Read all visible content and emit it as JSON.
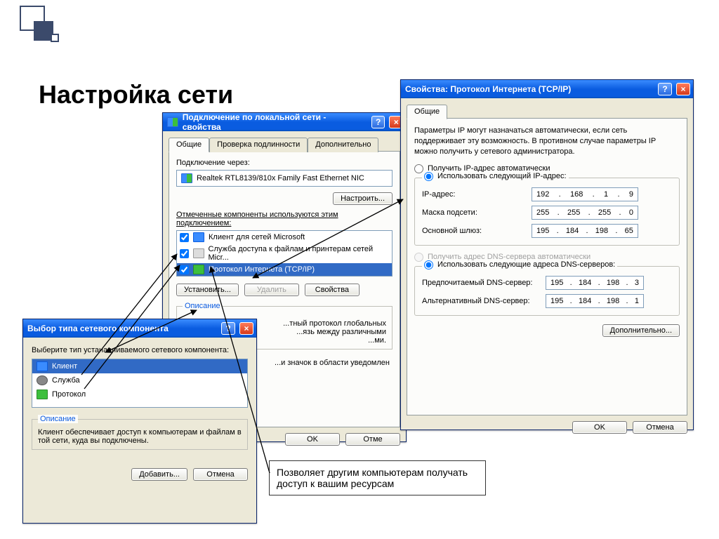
{
  "page_title": "Настройка сети",
  "win_props": {
    "title": "Подключение по локальной сети - свойства",
    "tabs": [
      "Общие",
      "Проверка подлинности",
      "Дополнительно"
    ],
    "connect_label": "Подключение через:",
    "adapter": "Realtek RTL8139/810x Family Fast Ethernet NIC",
    "configure_btn": "Настроить...",
    "components_label": "Отмеченные компоненты используются этим подключением:",
    "items": [
      "Клиент для сетей Microsoft",
      "Служба доступа к файлам и принтерам сетей Micr...",
      "Протокол Интернета (TCP/IP)"
    ],
    "install_btn": "Установить...",
    "remove_btn": "Удалить",
    "props_btn": "Свойства",
    "desc_title": "Описание",
    "desc_body1": "...тный протокол глобальных",
    "desc_body2": "...язь между различными",
    "desc_body3": "...ми.",
    "tray_label": "...и значок в области уведомлен",
    "ok": "OK",
    "cancel": "Отме"
  },
  "win_tcpip": {
    "title": "Свойства: Протокол Интернета (TCP/IP)",
    "tab": "Общие",
    "intro": "Параметры IP могут назначаться автоматически, если сеть поддерживает эту возможность. В противном случае параметры IP можно получить у сетевого администратора.",
    "radio_auto_ip": "Получить IP-адрес автоматически",
    "radio_manual_ip": "Использовать следующий IP-адрес:",
    "ip_label": "IP-адрес:",
    "ip": [
      "192",
      "168",
      "1",
      "9"
    ],
    "mask_label": "Маска подсети:",
    "mask": [
      "255",
      "255",
      "255",
      "0"
    ],
    "gw_label": "Основной шлюз:",
    "gw": [
      "195",
      "184",
      "198",
      "65"
    ],
    "radio_auto_dns": "Получить адрес DNS-сервера автоматически",
    "radio_manual_dns": "Использовать следующие адреса DNS-серверов:",
    "dns1_label": "Предпочитаемый DNS-сервер:",
    "dns1": [
      "195",
      "184",
      "198",
      "3"
    ],
    "dns2_label": "Альтернативный DNS-сервер:",
    "dns2": [
      "195",
      "184",
      "198",
      "1"
    ],
    "adv_btn": "Дополнительно...",
    "ok": "OK",
    "cancel": "Отмена"
  },
  "win_comp": {
    "title": "Выбор типа сетевого компонента",
    "prompt": "Выберите тип устанавливаемого сетевого компонента:",
    "items": [
      "Клиент",
      "Служба",
      "Протокол"
    ],
    "desc_title": "Описание",
    "desc_body": "Клиент обеспечивает доступ к компьютерам и файлам в той сети, куда вы подключены.",
    "add_btn": "Добавить...",
    "cancel_btn": "Отмена"
  },
  "note": "Позволяет другим компьютерам получать доступ к вашим ресурсам"
}
